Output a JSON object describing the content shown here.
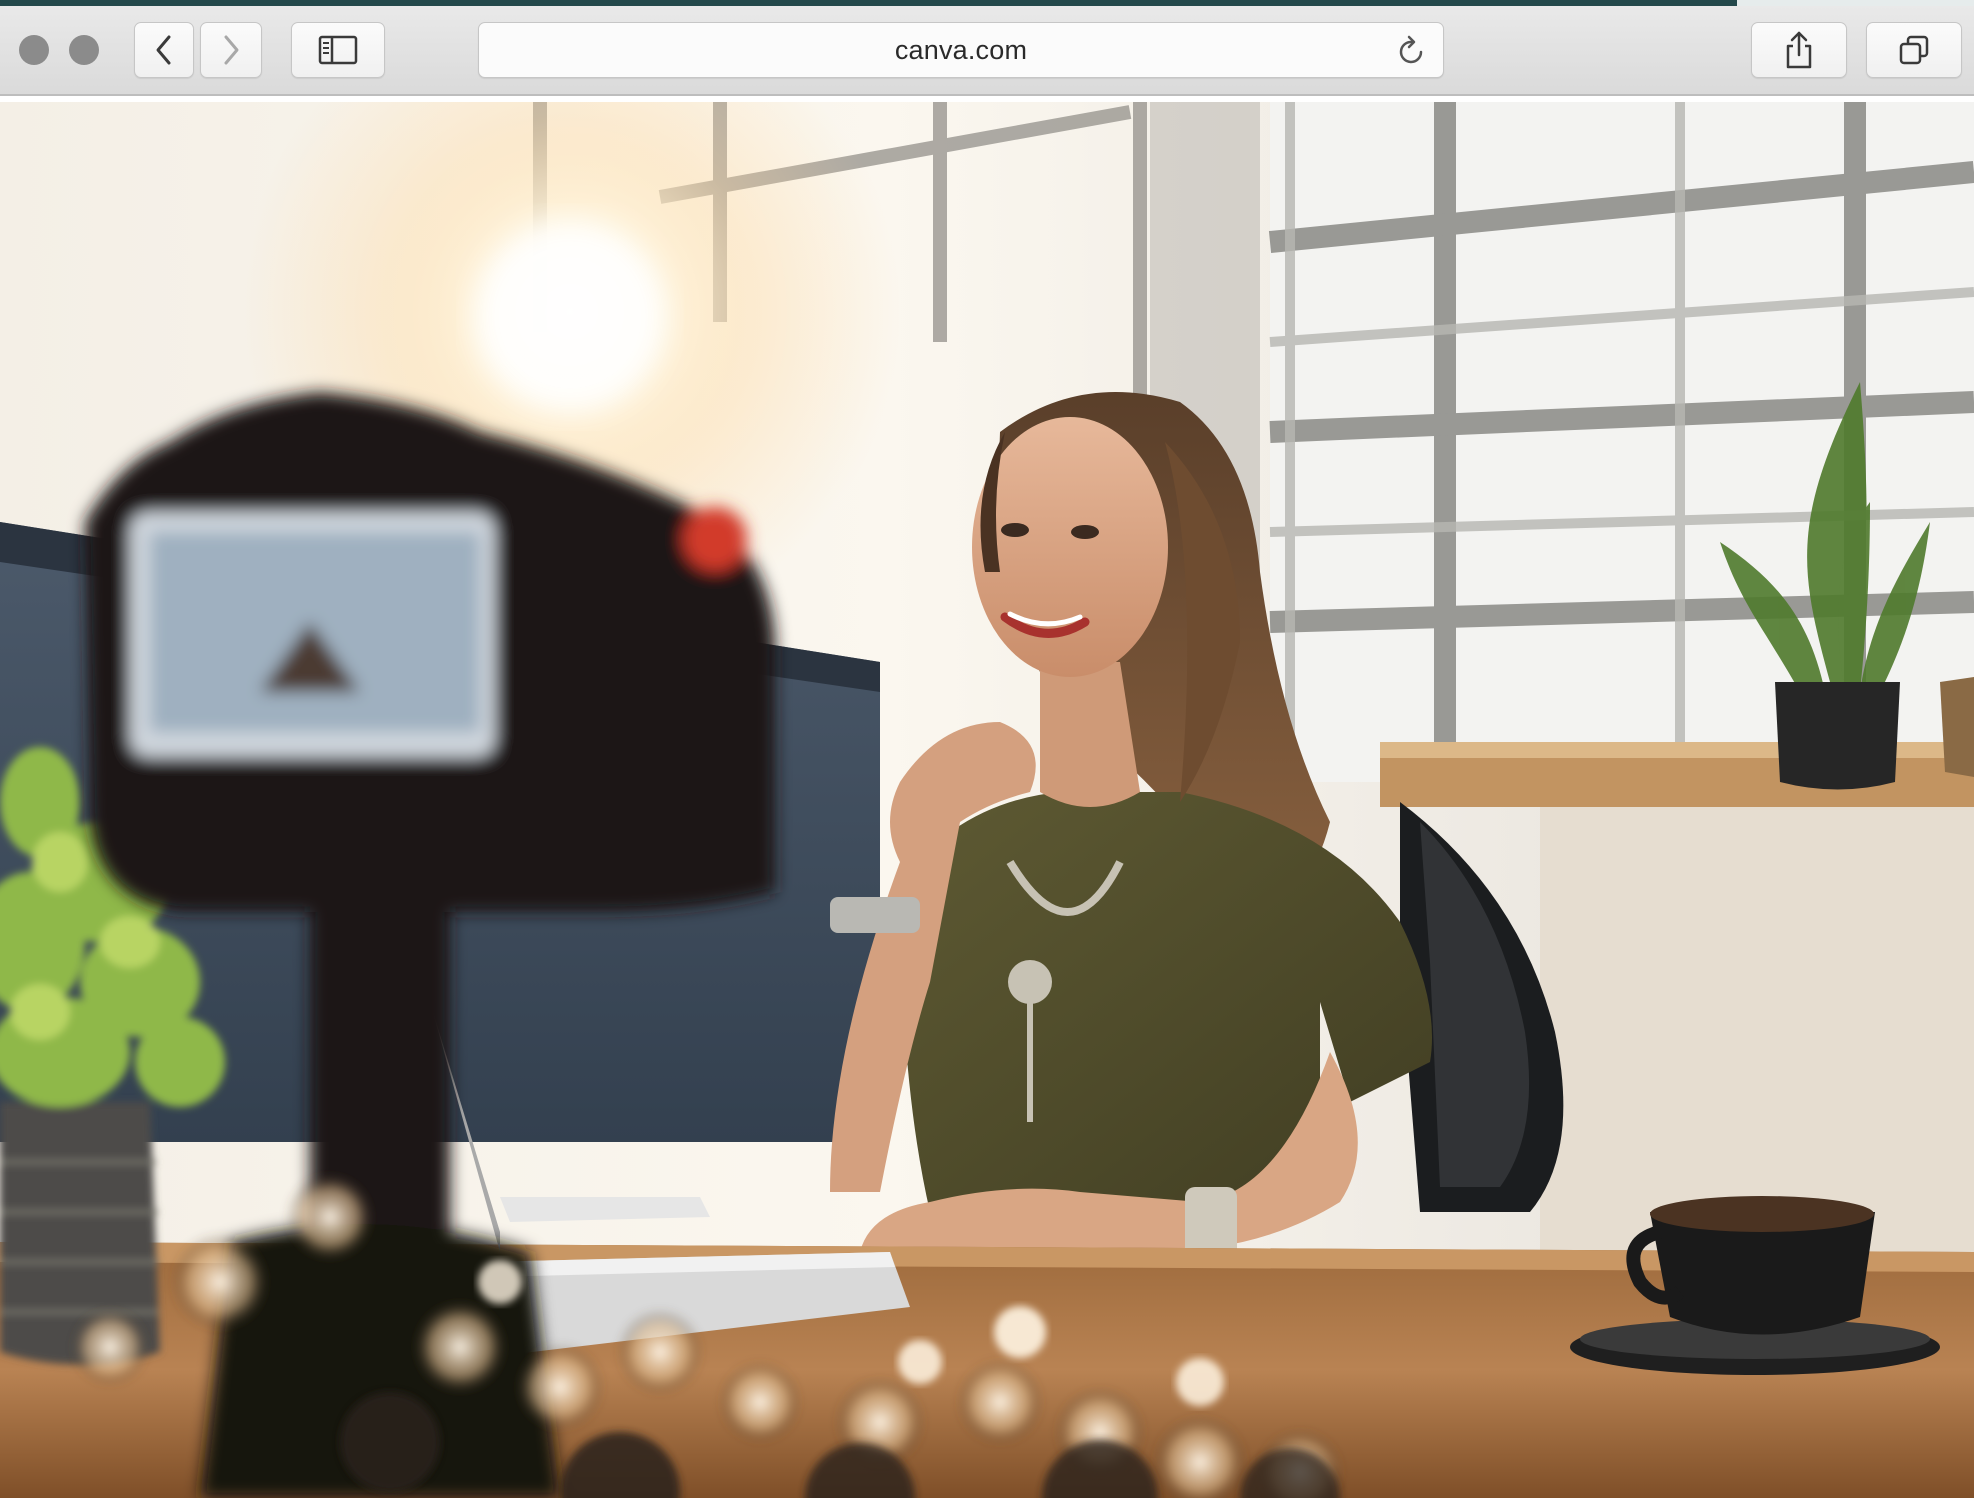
{
  "browser": {
    "address": "canva.com",
    "loading_progress_percent": 88,
    "icons": {
      "close": "window-close-dot",
      "minimize": "window-minimize-dot",
      "back": "chevron-left-icon",
      "forward": "chevron-right-icon",
      "sidebar": "sidebar-icon",
      "reload": "reload-icon",
      "share": "share-icon",
      "tabs": "tabs-overview-icon"
    }
  },
  "page": {
    "photo": "woman-vlogger-at-desk-with-camera"
  }
}
